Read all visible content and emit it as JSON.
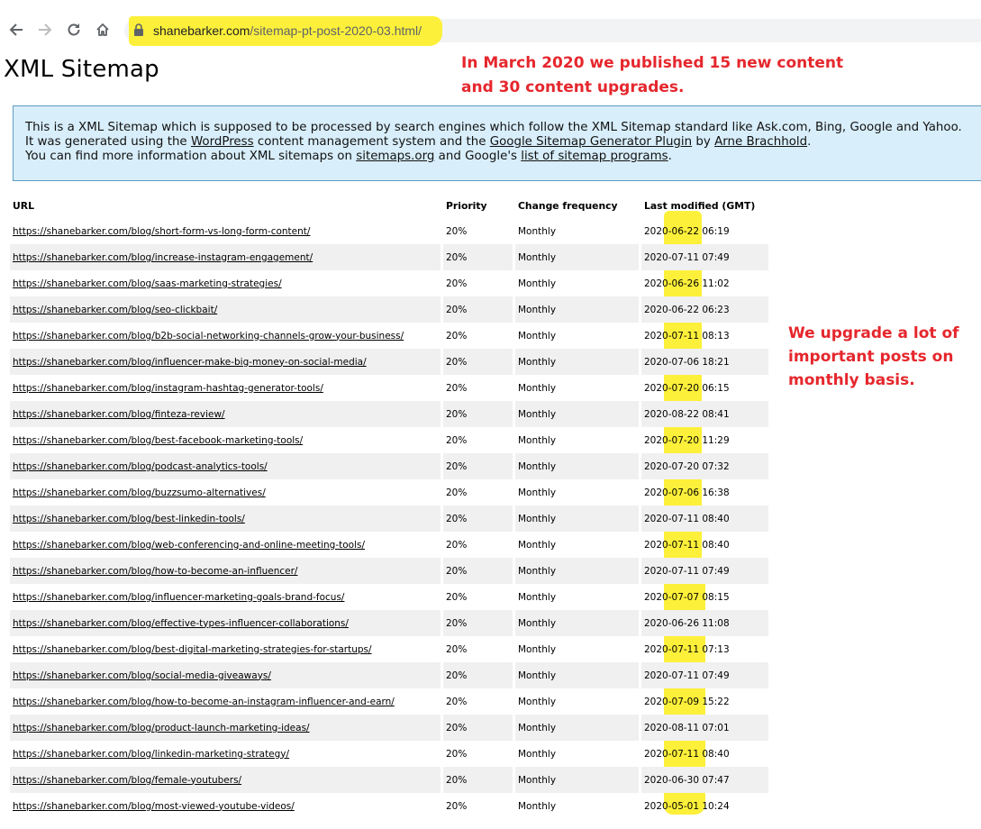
{
  "browser": {
    "url_domain": "shanebarker.com",
    "url_path": "/sitemap-pt-post-2020-03.html/"
  },
  "page": {
    "title": "XML Sitemap",
    "note_top_line1": "In March 2020 we published 15 new content",
    "note_top_line2": "and 30 content upgrades.",
    "note_side_line1": "We upgrade a lot of",
    "note_side_line2": "important posts on",
    "note_side_line3": "monthly basis."
  },
  "info": {
    "line1": "This is a XML Sitemap which is supposed to be processed by search engines which follow the XML Sitemap standard like Ask.com, Bing, Google and Yahoo.",
    "line2_a": "It was generated using the ",
    "line2_link1": "WordPress",
    "line2_b": " content management system and the ",
    "line2_link2": "Google Sitemap Generator Plugin",
    "line2_c": " by ",
    "line2_link3": "Arne Brachhold",
    "line2_d": ".",
    "line3_a": "You can find more information about XML sitemaps on ",
    "line3_link1": "sitemaps.org",
    "line3_b": " and Google's ",
    "line3_link2": "list of sitemap programs",
    "line3_c": "."
  },
  "table": {
    "headers": {
      "url": "URL",
      "priority": "Priority",
      "change": "Change frequency",
      "modified": "Last modified (GMT)"
    },
    "rows": [
      {
        "url": "https://shanebarker.com/blog/short-form-vs-long-form-content/",
        "priority": "20%",
        "change": "Monthly",
        "modified": "2020-06-22 06:19"
      },
      {
        "url": "https://shanebarker.com/blog/increase-instagram-engagement/",
        "priority": "20%",
        "change": "Monthly",
        "modified": "2020-07-11 07:49"
      },
      {
        "url": "https://shanebarker.com/blog/saas-marketing-strategies/",
        "priority": "20%",
        "change": "Monthly",
        "modified": "2020-06-26 11:02"
      },
      {
        "url": "https://shanebarker.com/blog/seo-clickbait/",
        "priority": "20%",
        "change": "Monthly",
        "modified": "2020-06-22 06:23"
      },
      {
        "url": "https://shanebarker.com/blog/b2b-social-networking-channels-grow-your-business/",
        "priority": "20%",
        "change": "Monthly",
        "modified": "2020-07-11 08:13"
      },
      {
        "url": "https://shanebarker.com/blog/influencer-make-big-money-on-social-media/",
        "priority": "20%",
        "change": "Monthly",
        "modified": "2020-07-06 18:21"
      },
      {
        "url": "https://shanebarker.com/blog/instagram-hashtag-generator-tools/",
        "priority": "20%",
        "change": "Monthly",
        "modified": "2020-07-20 06:15"
      },
      {
        "url": "https://shanebarker.com/blog/finteza-review/",
        "priority": "20%",
        "change": "Monthly",
        "modified": "2020-08-22 08:41"
      },
      {
        "url": "https://shanebarker.com/blog/best-facebook-marketing-tools/",
        "priority": "20%",
        "change": "Monthly",
        "modified": "2020-07-20 11:29"
      },
      {
        "url": "https://shanebarker.com/blog/podcast-analytics-tools/",
        "priority": "20%",
        "change": "Monthly",
        "modified": "2020-07-20 07:32"
      },
      {
        "url": "https://shanebarker.com/blog/buzzsumo-alternatives/",
        "priority": "20%",
        "change": "Monthly",
        "modified": "2020-07-06 16:38"
      },
      {
        "url": "https://shanebarker.com/blog/best-linkedin-tools/",
        "priority": "20%",
        "change": "Monthly",
        "modified": "2020-07-11 08:40"
      },
      {
        "url": "https://shanebarker.com/blog/web-conferencing-and-online-meeting-tools/",
        "priority": "20%",
        "change": "Monthly",
        "modified": "2020-07-11 08:40"
      },
      {
        "url": "https://shanebarker.com/blog/how-to-become-an-influencer/",
        "priority": "20%",
        "change": "Monthly",
        "modified": "2020-07-11 07:49"
      },
      {
        "url": "https://shanebarker.com/blog/influencer-marketing-goals-brand-focus/",
        "priority": "20%",
        "change": "Monthly",
        "modified": "2020-07-07 08:15"
      },
      {
        "url": "https://shanebarker.com/blog/effective-types-influencer-collaborations/",
        "priority": "20%",
        "change": "Monthly",
        "modified": "2020-06-26 11:08"
      },
      {
        "url": "https://shanebarker.com/blog/best-digital-marketing-strategies-for-startups/",
        "priority": "20%",
        "change": "Monthly",
        "modified": "2020-07-11 07:13"
      },
      {
        "url": "https://shanebarker.com/blog/social-media-giveaways/",
        "priority": "20%",
        "change": "Monthly",
        "modified": "2020-07-11 07:49"
      },
      {
        "url": "https://shanebarker.com/blog/how-to-become-an-instagram-influencer-and-earn/",
        "priority": "20%",
        "change": "Monthly",
        "modified": "2020-07-09 15:22"
      },
      {
        "url": "https://shanebarker.com/blog/product-launch-marketing-ideas/",
        "priority": "20%",
        "change": "Monthly",
        "modified": "2020-08-11 07:01"
      },
      {
        "url": "https://shanebarker.com/blog/linkedin-marketing-strategy/",
        "priority": "20%",
        "change": "Monthly",
        "modified": "2020-07-11 08:40"
      },
      {
        "url": "https://shanebarker.com/blog/female-youtubers/",
        "priority": "20%",
        "change": "Monthly",
        "modified": "2020-06-30 07:47"
      },
      {
        "url": "https://shanebarker.com/blog/most-viewed-youtube-videos/",
        "priority": "20%",
        "change": "Monthly",
        "modified": "2020-05-01 10:24"
      }
    ]
  },
  "colors": {
    "highlight": "#fdf03a",
    "note_red": "#e5272d",
    "infobox_bg": "#d8eefa"
  },
  "icons": [
    "back-arrow-icon",
    "forward-arrow-icon",
    "reload-icon",
    "home-icon",
    "lock-icon"
  ]
}
